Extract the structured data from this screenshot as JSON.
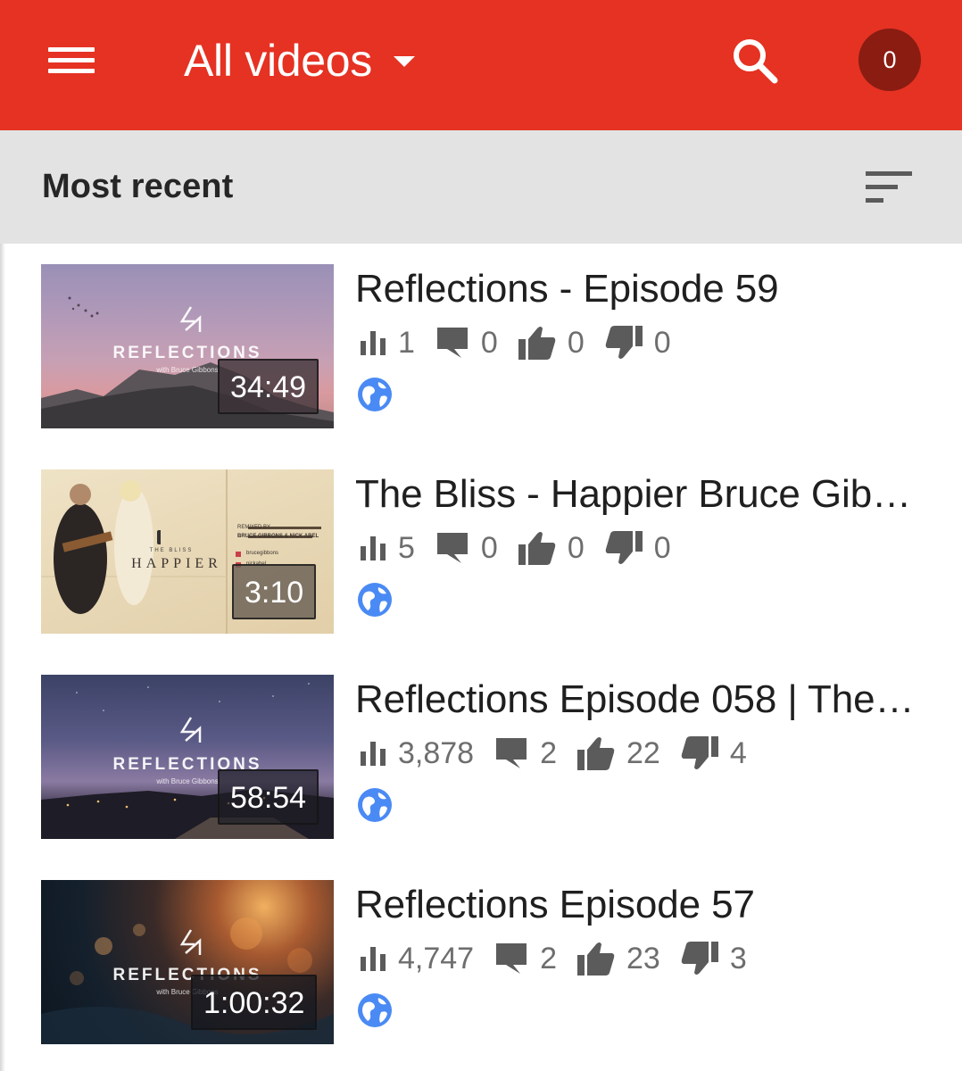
{
  "appbar": {
    "menu_icon": "hamburger-menu-icon",
    "title": "All videos",
    "dropdown_icon": "caret-down-icon",
    "search_icon": "search-icon",
    "notification_count": "0"
  },
  "sortbar": {
    "label": "Most recent",
    "sort_icon": "sort-icon"
  },
  "colors": {
    "appbar": "#e53222",
    "badge": "#8a1c12",
    "sortbar": "#e3e3e3",
    "icon_gray": "#5b5b5b",
    "globe_blue": "#4a8af4"
  },
  "videos": [
    {
      "title": "Reflections - Episode 59",
      "thumbnail_text": "REFLECTIONS",
      "thumbnail_subtext": "with Bruce Gibbons",
      "duration": "34:49",
      "views": "1",
      "comments": "0",
      "likes": "0",
      "dislikes": "0",
      "visibility_icon": "public-globe-icon"
    },
    {
      "title": "The Bliss - Happier Bruce Gib…",
      "thumbnail_text": "HAPPIER",
      "thumbnail_subtext": "THE BLISS",
      "thumbnail_credit": "REMIXED BY",
      "thumbnail_credit_names": "BRUCE GIBBONS & NICK ABEL",
      "thumbnail_handle_1": "brucegibbons",
      "thumbnail_handle_2": "nickabel",
      "duration": "3:10",
      "views": "5",
      "comments": "0",
      "likes": "0",
      "dislikes": "0",
      "visibility_icon": "public-globe-icon"
    },
    {
      "title": "Reflections Episode 058 | The…",
      "thumbnail_text": "REFLECTIONS",
      "thumbnail_subtext": "with Bruce Gibbons",
      "duration": "58:54",
      "views": "3,878",
      "comments": "2",
      "likes": "22",
      "dislikes": "4",
      "visibility_icon": "public-globe-icon"
    },
    {
      "title": "Reflections Episode 57",
      "thumbnail_text": "REFLECTIONS",
      "thumbnail_subtext": "with Bruce Gibbons",
      "duration": "1:00:32",
      "views": "4,747",
      "comments": "2",
      "likes": "23",
      "dislikes": "3",
      "visibility_icon": "public-globe-icon"
    }
  ]
}
